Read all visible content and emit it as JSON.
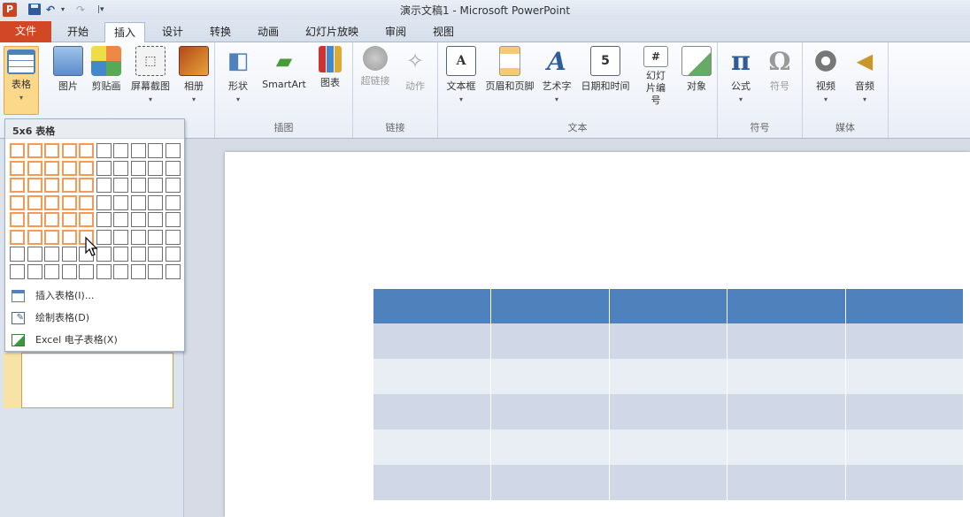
{
  "window": {
    "title": "演示文稿1 - Microsoft PowerPoint"
  },
  "quick_access": {
    "app_icon": "P",
    "items": [
      "save-icon",
      "undo-icon",
      "redo-icon",
      "customize-icon"
    ]
  },
  "tabs": [
    "文件",
    "开始",
    "插入",
    "设计",
    "转换",
    "动画",
    "幻灯片放映",
    "审阅",
    "视图"
  ],
  "active_tab": "插入",
  "ribbon": {
    "groups": [
      {
        "label": "",
        "buttons": [
          {
            "label": "表格",
            "icon": "table-icon"
          },
          {
            "label": "图片",
            "icon": "picture-icon"
          },
          {
            "label": "剪贴画",
            "icon": "clipart-icon"
          },
          {
            "label": "屏幕截图",
            "icon": "screenshot-icon"
          },
          {
            "label": "相册",
            "icon": "album-icon"
          }
        ]
      },
      {
        "label": "插图",
        "buttons": [
          {
            "label": "形状",
            "icon": "shapes-icon"
          },
          {
            "label": "SmartArt",
            "icon": "smartart-icon"
          },
          {
            "label": "图表",
            "icon": "chart-icon"
          }
        ]
      },
      {
        "label": "链接",
        "buttons": [
          {
            "label": "超链接",
            "icon": "hyperlink-icon",
            "disabled": true
          },
          {
            "label": "动作",
            "icon": "action-icon",
            "disabled": true
          }
        ]
      },
      {
        "label": "文本",
        "buttons": [
          {
            "label": "文本框",
            "icon": "textbox-icon"
          },
          {
            "label": "页眉和页脚",
            "icon": "header-footer-icon"
          },
          {
            "label": "艺术字",
            "icon": "wordart-icon"
          },
          {
            "label": "日期和时间",
            "icon": "date-time-icon"
          },
          {
            "label": "幻灯片编号",
            "icon": "slide-number-icon"
          },
          {
            "label": "对象",
            "icon": "object-icon"
          }
        ]
      },
      {
        "label": "符号",
        "buttons": [
          {
            "label": "公式",
            "icon": "equation-icon",
            "glyph": "π"
          },
          {
            "label": "符号",
            "icon": "symbol-icon",
            "glyph": "Ω",
            "disabled": true
          }
        ]
      },
      {
        "label": "媒体",
        "buttons": [
          {
            "label": "视频",
            "icon": "video-icon"
          },
          {
            "label": "音频",
            "icon": "audio-icon"
          }
        ]
      }
    ]
  },
  "table_dropdown": {
    "header": "5x6 表格",
    "grid_cols": 10,
    "grid_rows": 8,
    "selected_cols": 5,
    "selected_rows": 6,
    "menu_items": [
      "插入表格(I)...",
      "绘制表格(D)",
      "Excel 电子表格(X)"
    ]
  },
  "slide_table": {
    "rows": 6,
    "cols": 5
  },
  "colors": {
    "file_tab": "#d24726",
    "table_header": "#4f81bd",
    "table_band_dark": "#d0d8e8",
    "table_band_light": "#e9edf4",
    "grid_highlight": "#f59a55"
  }
}
